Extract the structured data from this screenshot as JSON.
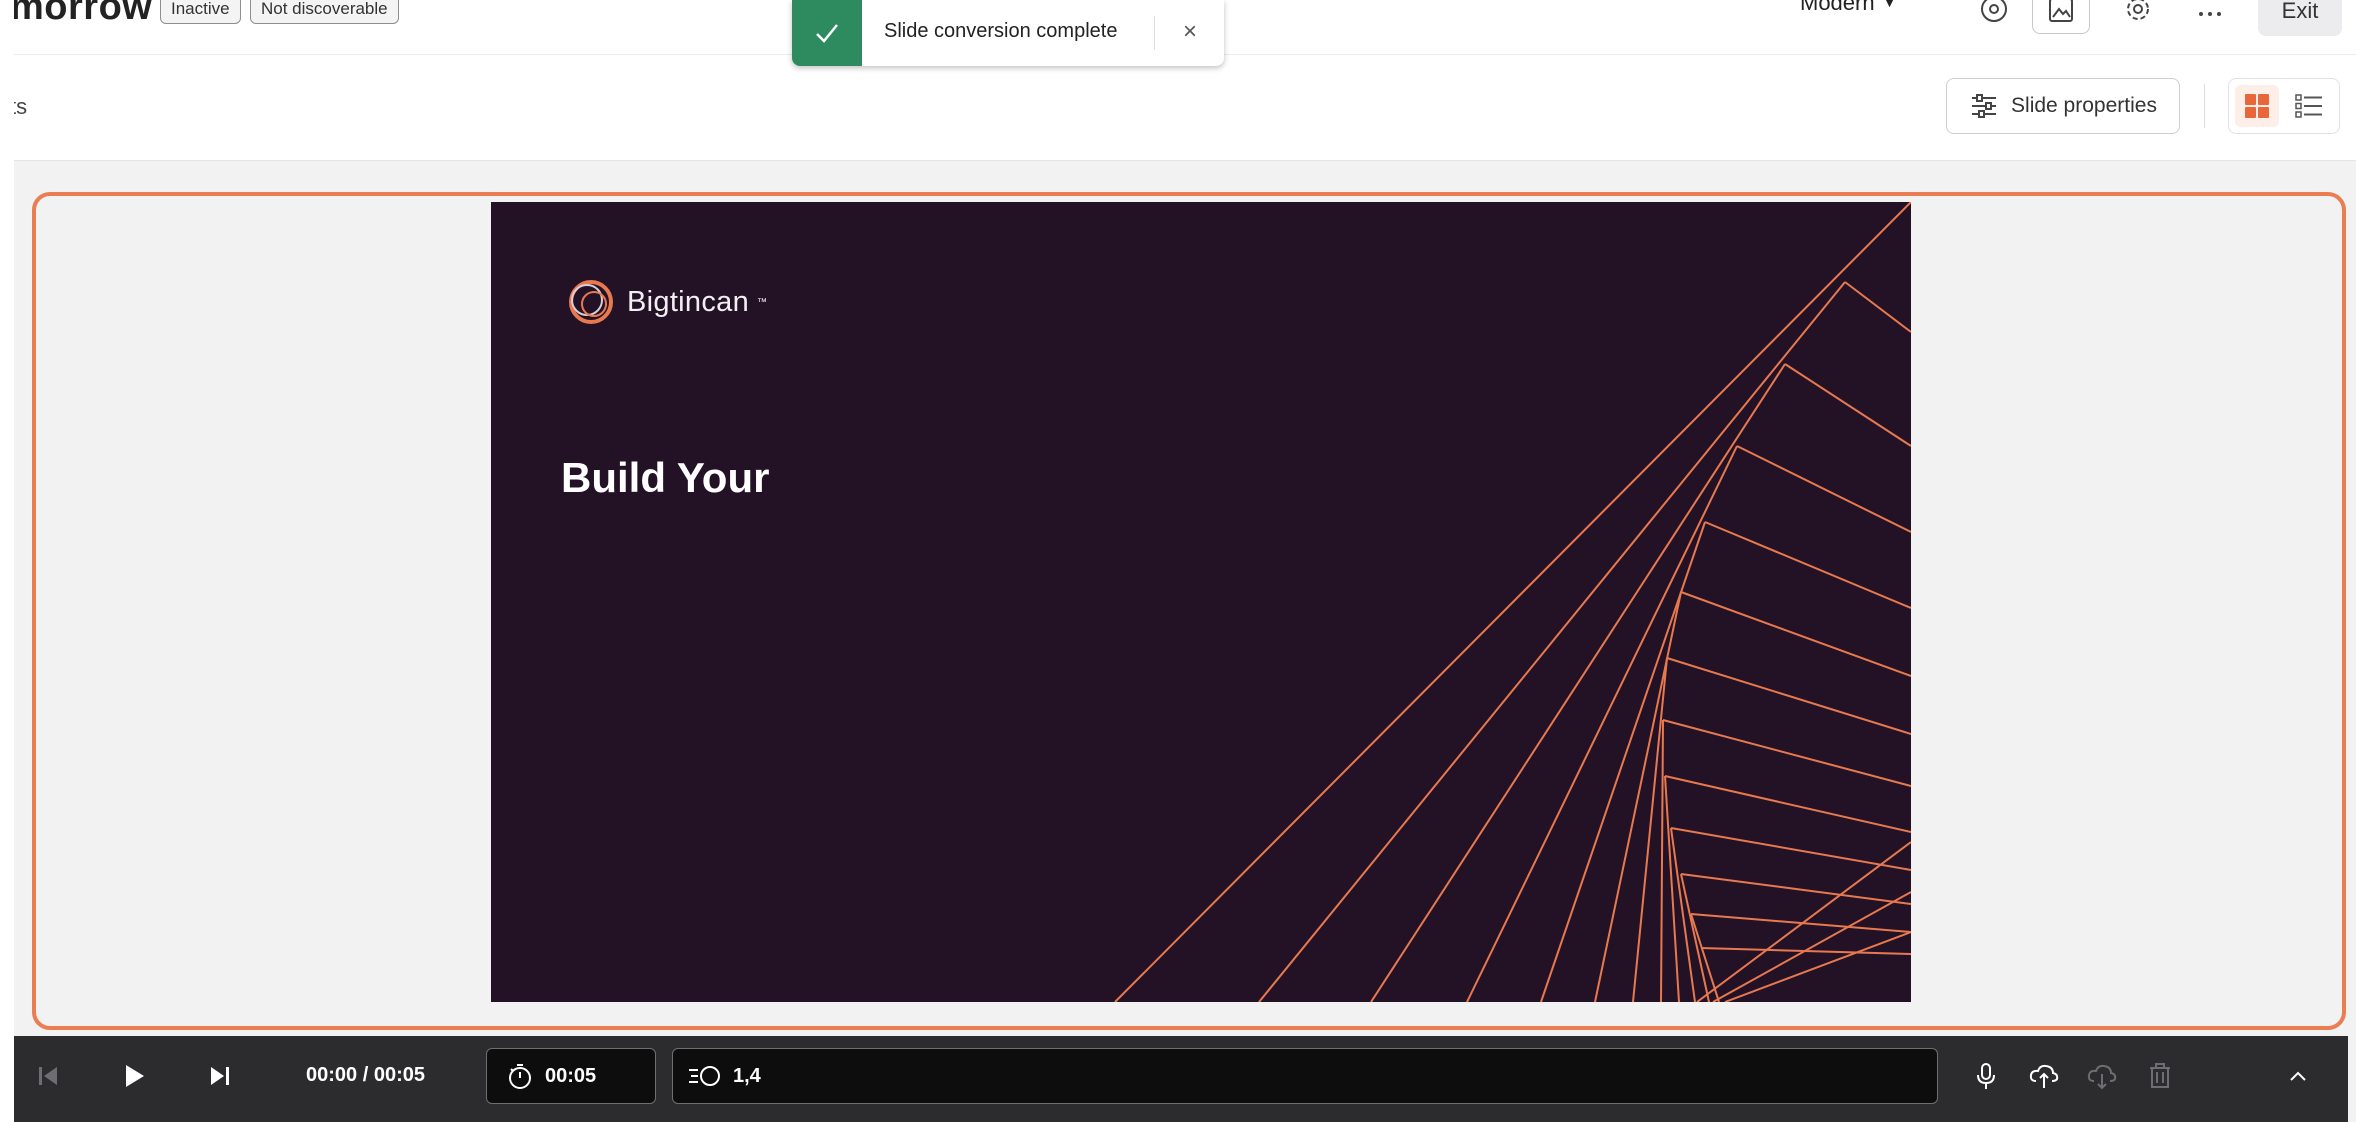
{
  "header": {
    "title": "morrow",
    "badges": [
      "Inactive",
      "Not discoverable"
    ],
    "theme_selector": "Modern",
    "exit_label": "Exit",
    "row2_text": "ts",
    "slide_properties_label": "Slide properties",
    "icons": [
      "eye-icon",
      "image-icon",
      "settings-gear-icon",
      "more-icon",
      "sliders-icon",
      "grid-view-icon",
      "list-view-icon"
    ]
  },
  "toast": {
    "message": "Slide conversion complete",
    "icon": "check-icon",
    "close": "×",
    "color": "#2e8a5f"
  },
  "slide": {
    "logo_text": "Bigtincan",
    "logo_tm": "™",
    "title": "Build Your",
    "background": "#231226",
    "accent": "#e8794f"
  },
  "player": {
    "time": "00:00 / 00:05",
    "duration": "00:05",
    "animations": "1,4",
    "icons": [
      "skip-start-icon",
      "play-icon",
      "skip-next-icon",
      "stopwatch-icon",
      "animation-icon",
      "microphone-icon",
      "cloud-upload-icon",
      "cloud-download-icon",
      "trash-icon",
      "chevron-up-icon"
    ]
  },
  "colors": {
    "frame_accent": "#ea7d52",
    "canvas_bg": "#f2f2f3",
    "player_bg": "#2c2c2e"
  }
}
